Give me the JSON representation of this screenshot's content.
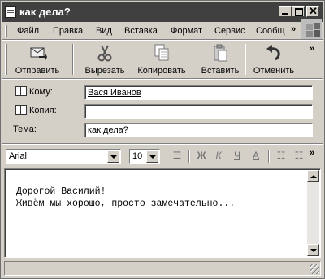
{
  "window": {
    "title": "как дела?"
  },
  "menu": {
    "items": [
      "Файл",
      "Правка",
      "Вид",
      "Вставка",
      "Формат",
      "Сервис",
      "Сообщ"
    ],
    "more": "»"
  },
  "toolbar": {
    "buttons": [
      {
        "label": "Отправить",
        "icon": "send-icon"
      },
      {
        "label": "Вырезать",
        "icon": "scissors-icon"
      },
      {
        "label": "Копировать",
        "icon": "copy-icon"
      },
      {
        "label": "Вставить",
        "icon": "paste-icon"
      },
      {
        "label": "Отменить",
        "icon": "undo-icon"
      }
    ],
    "more": "»"
  },
  "header": {
    "to_label": "Кому:",
    "to_value": "Вася Иванов",
    "cc_label": "Копия:",
    "cc_value": "",
    "subject_label": "Тема:",
    "subject_value": "как дела?"
  },
  "format": {
    "font": "Arial",
    "size": "10",
    "more": "»"
  },
  "body": {
    "text": "Дорогой Василий!\nЖивём мы хорошо, просто замечательно..."
  },
  "colors": {
    "titlebar": "#404040",
    "chrome": "#d4d0c8"
  }
}
